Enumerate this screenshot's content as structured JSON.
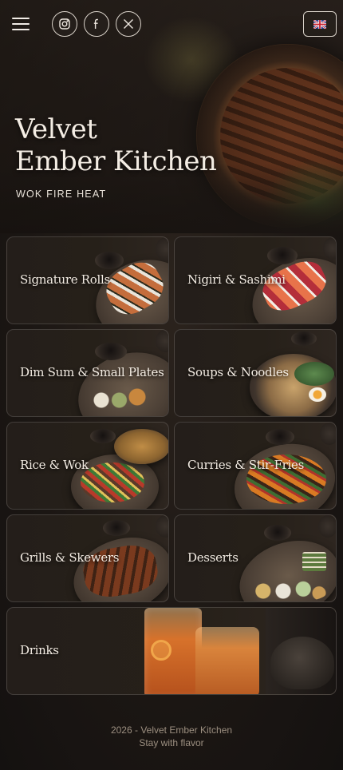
{
  "header": {
    "menu_icon": "hamburger-menu-icon",
    "social": [
      {
        "name": "instagram",
        "icon": "instagram-icon"
      },
      {
        "name": "facebook",
        "icon": "facebook-icon"
      },
      {
        "name": "x",
        "icon": "x-icon"
      }
    ],
    "language_icon": "uk-flag-icon"
  },
  "hero": {
    "title_line1": "Velvet",
    "title_line2": "Ember Kitchen",
    "subtitle": "WOK FIRE HEAT"
  },
  "categories": [
    {
      "label": "Signature Rolls"
    },
    {
      "label": "Nigiri & Sashimi"
    },
    {
      "label": "Dim Sum & Small Plates"
    },
    {
      "label": "Soups & Noodles"
    },
    {
      "label": "Rice & Wok"
    },
    {
      "label": "Curries & Stir-Fries"
    },
    {
      "label": "Grills & Skewers"
    },
    {
      "label": "Desserts"
    },
    {
      "label": "Drinks"
    }
  ],
  "footer": {
    "copyright": "2026 - Velvet Ember Kitchen",
    "tagline": "Stay with flavor"
  },
  "colors": {
    "background": "#1a1512",
    "text": "#efe7dc",
    "muted": "#9c8f80"
  }
}
